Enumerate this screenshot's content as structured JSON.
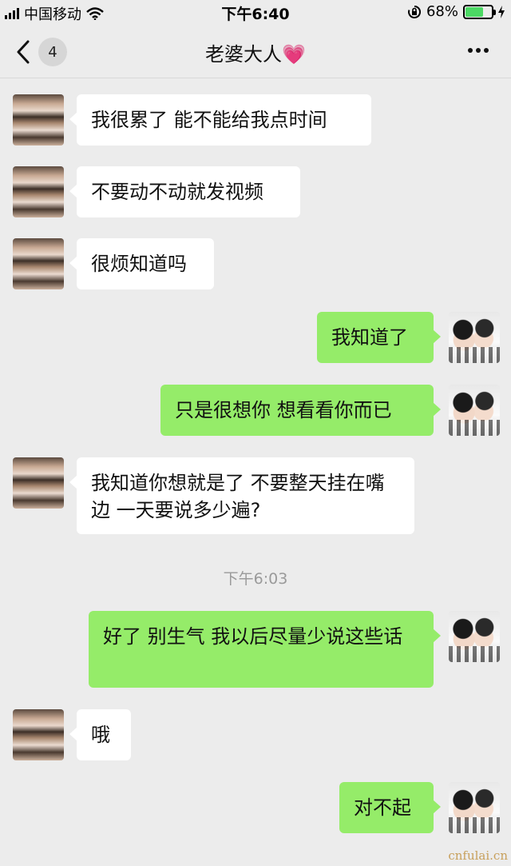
{
  "status_bar": {
    "carrier": "中国移动",
    "time": "下午6:40",
    "battery": "68%",
    "battery_level": 0.68
  },
  "nav": {
    "unread_count": "4",
    "title": "老婆大人💗"
  },
  "messages": [
    {
      "side": "in",
      "text": "我很累了 能不能给我点时间"
    },
    {
      "side": "in",
      "text": "不要动不动就发视频"
    },
    {
      "side": "in",
      "text": "很烦知道吗"
    },
    {
      "side": "out",
      "text": "我知道了"
    },
    {
      "side": "out",
      "text": "只是很想你 想看看你而已"
    },
    {
      "side": "in",
      "text": "我知道你想就是了 不要整天挂在嘴边 一天要说多少遍?"
    },
    {
      "side": "out",
      "text": "好了 别生气 我以后尽量少说这些话"
    },
    {
      "side": "in",
      "text": "哦"
    },
    {
      "side": "out",
      "text": "对不起"
    }
  ],
  "timestamp": "下午6:03",
  "watermark": "cnfulai.cn",
  "colors": {
    "background": "#ececec",
    "incoming_bubble": "#ffffff",
    "outgoing_bubble": "#95ec69",
    "battery_fill": "#4cd964"
  }
}
